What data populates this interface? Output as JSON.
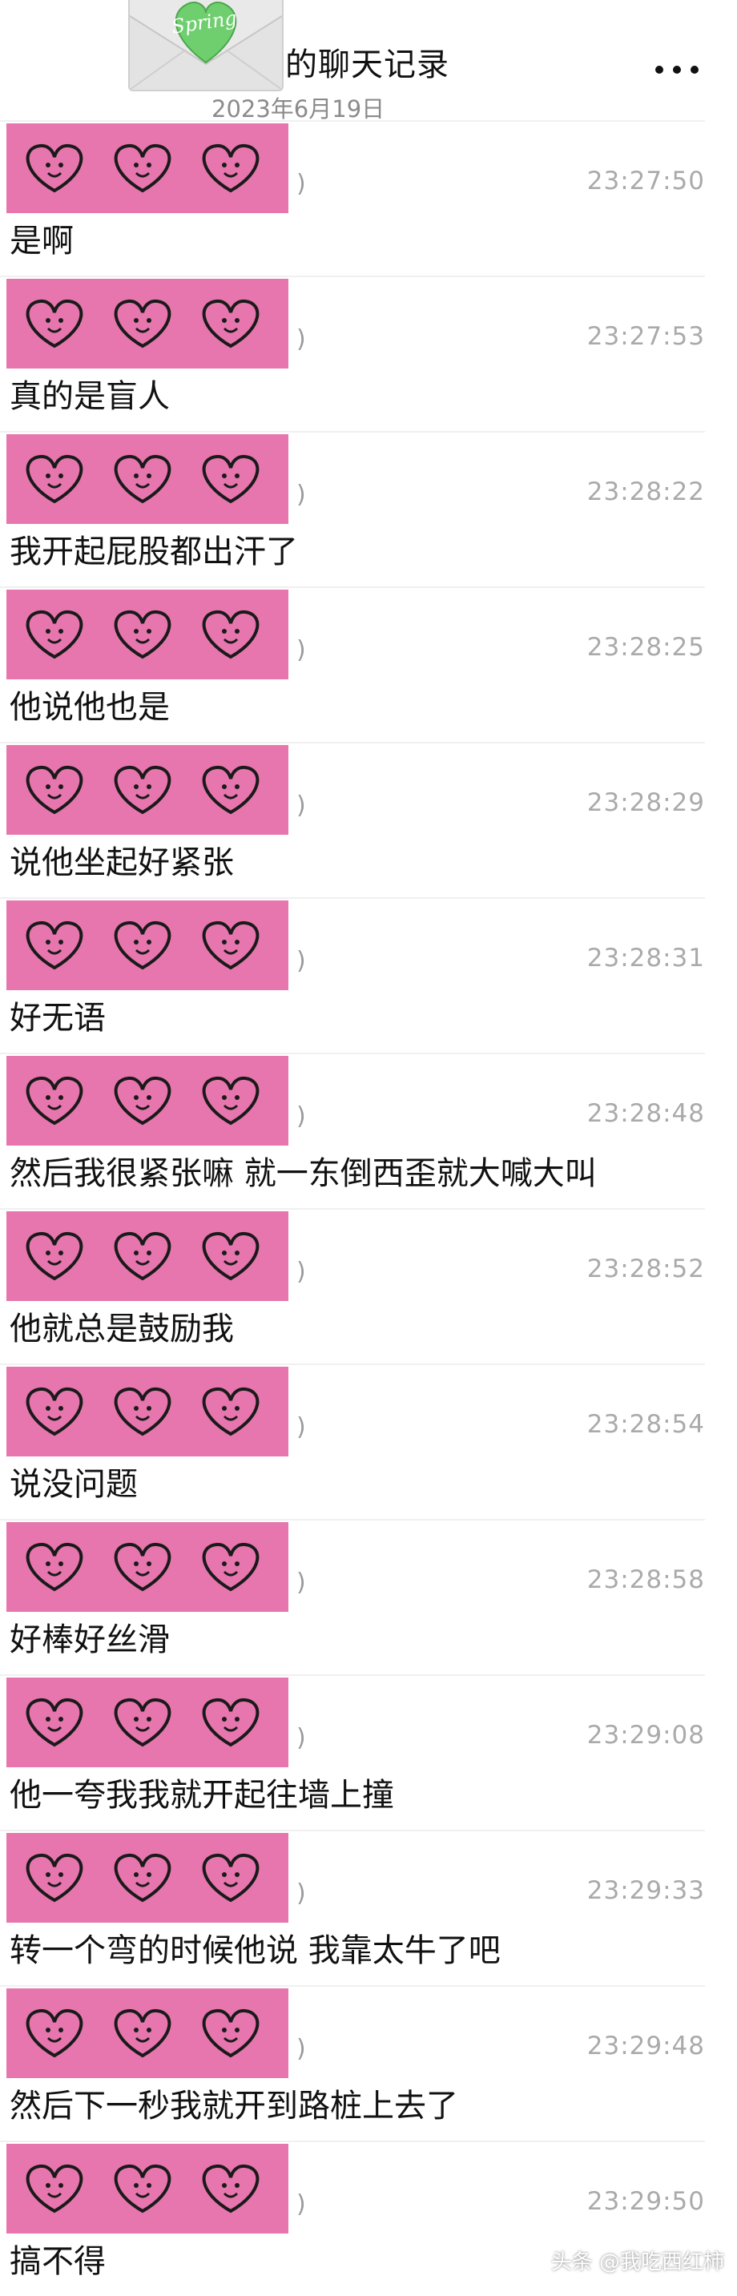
{
  "header": {
    "avatar_label": "Spring",
    "title": "的聊天记录",
    "date": "2023年6月19日",
    "more_icon": "more-horizontal-icon"
  },
  "messages": [
    {
      "time": "23:27:50",
      "text": "是啊"
    },
    {
      "time": "23:27:53",
      "text": "真的是盲人"
    },
    {
      "time": "23:28:22",
      "text": "我开起屁股都出汗了"
    },
    {
      "time": "23:28:25",
      "text": "他说他也是"
    },
    {
      "time": "23:28:29",
      "text": "说他坐起好紧张"
    },
    {
      "time": "23:28:31",
      "text": "好无语"
    },
    {
      "time": "23:28:48",
      "text": "然后我很紧张嘛 就一东倒西歪就大喊大叫"
    },
    {
      "time": "23:28:52",
      "text": "他就总是鼓励我"
    },
    {
      "time": "23:28:54",
      "text": "说没问题"
    },
    {
      "time": "23:28:58",
      "text": "好棒好丝滑"
    },
    {
      "time": "23:29:08",
      "text": "他一夸我我就开起往墙上撞"
    },
    {
      "time": "23:29:33",
      "text": "转一个弯的时候他说 我靠太牛了吧"
    },
    {
      "time": "23:29:48",
      "text": "然后下一秒我就开到路桩上去了"
    },
    {
      "time": "23:29:50",
      "text": "搞不得"
    }
  ],
  "sticker": {
    "icon": "heart-face-icon",
    "color": "#e676ad",
    "paren": ")"
  },
  "watermark": "头条 @我吃西红柿"
}
